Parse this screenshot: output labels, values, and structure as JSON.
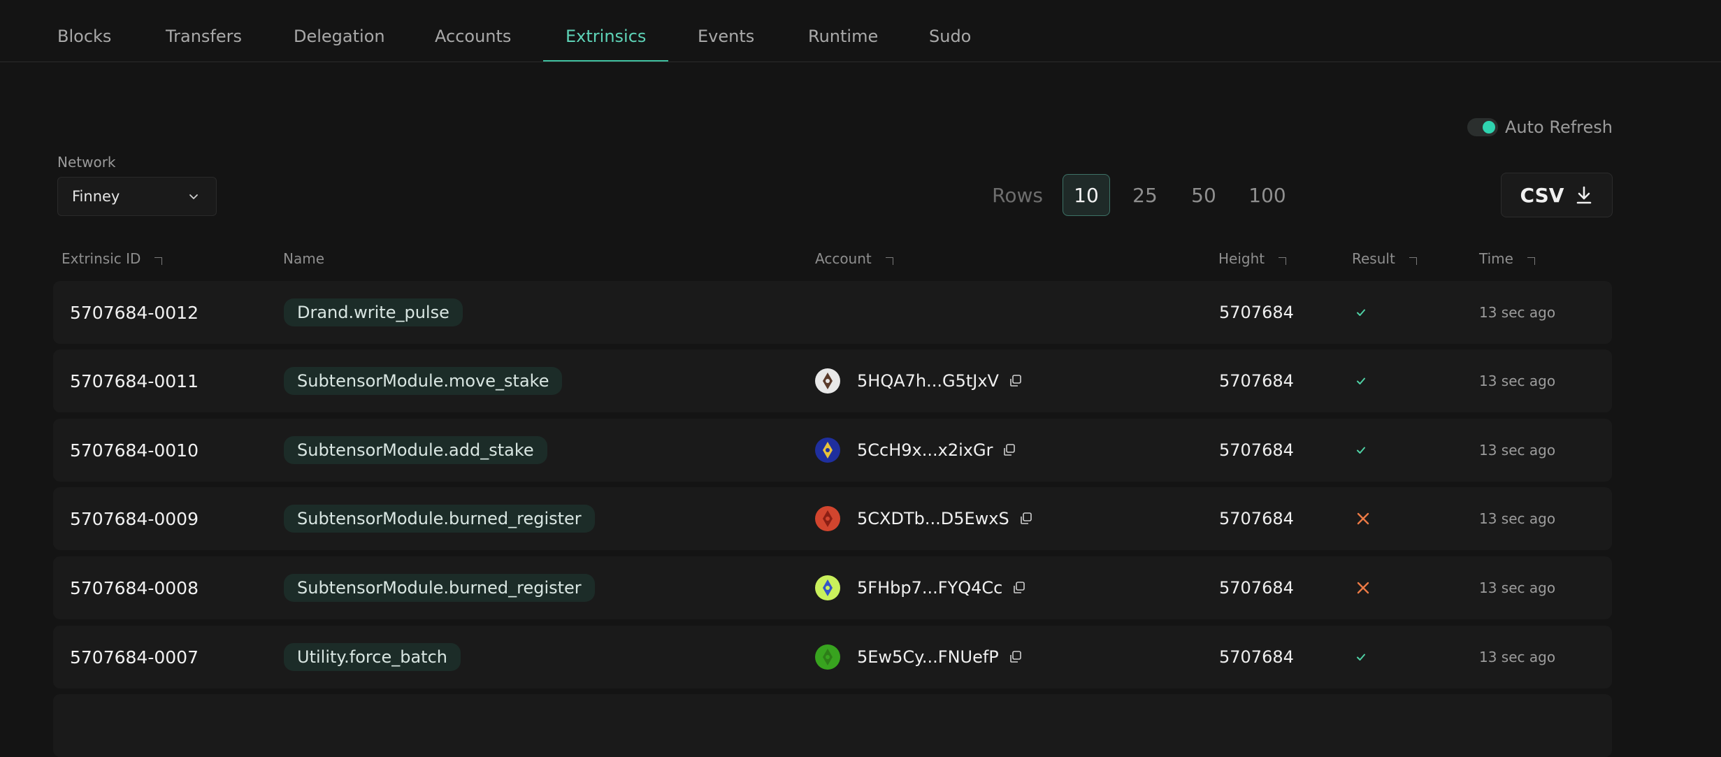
{
  "nav": {
    "tabs": [
      {
        "label": "Blocks"
      },
      {
        "label": "Transfers"
      },
      {
        "label": "Delegation"
      },
      {
        "label": "Accounts"
      },
      {
        "label": "Extrinsics",
        "active": true
      },
      {
        "label": "Events"
      },
      {
        "label": "Runtime"
      },
      {
        "label": "Sudo"
      }
    ]
  },
  "controls": {
    "auto_refresh_label": "Auto Refresh",
    "auto_refresh_on": true,
    "network_label": "Network",
    "network_value": "Finney",
    "rows_label": "Rows",
    "rows_options": [
      "10",
      "25",
      "50",
      "100"
    ],
    "rows_selected": "10",
    "csv_label": "CSV"
  },
  "table": {
    "headers": {
      "id": "Extrinsic ID",
      "name": "Name",
      "account": "Account",
      "height": "Height",
      "result": "Result",
      "time": "Time"
    },
    "rows": [
      {
        "id": "5707684-0012",
        "name": "Drand.write_pulse",
        "account": "",
        "avatar_colors": [],
        "height": "5707684",
        "result": "success",
        "time": "13 sec ago"
      },
      {
        "id": "5707684-0011",
        "name": "SubtensorModule.move_stake",
        "account": "5HQA7h...G5tJxV",
        "avatar_colors": [
          "#e8e8e8",
          "#5a3a2a"
        ],
        "height": "5707684",
        "result": "success",
        "time": "13 sec ago"
      },
      {
        "id": "5707684-0010",
        "name": "SubtensorModule.add_stake",
        "account": "5CcH9x...x2ixGr",
        "avatar_colors": [
          "#1f2f9e",
          "#e8c23a"
        ],
        "height": "5707684",
        "result": "success",
        "time": "13 sec ago"
      },
      {
        "id": "5707684-0009",
        "name": "SubtensorModule.burned_register",
        "account": "5CXDTb...D5EwxS",
        "avatar_colors": [
          "#d2452e",
          "#8c1f14"
        ],
        "height": "5707684",
        "result": "failed",
        "time": "13 sec ago"
      },
      {
        "id": "5707684-0008",
        "name": "SubtensorModule.burned_register",
        "account": "5FHbp7...FYQ4Cc",
        "avatar_colors": [
          "#c9f05c",
          "#3454c8"
        ],
        "height": "5707684",
        "result": "failed",
        "time": "13 sec ago"
      },
      {
        "id": "5707684-0007",
        "name": "Utility.force_batch",
        "account": "5Ew5Cy...FNUefP",
        "avatar_colors": [
          "#38a31f",
          "#2d7e18"
        ],
        "height": "5707684",
        "result": "success",
        "time": "13 sec ago"
      }
    ]
  },
  "colors": {
    "accent": "#5ed3b7",
    "success": "#4fd1a5",
    "failed": "#ec7a45",
    "background": "#141414",
    "row_background": "#1a1a1a"
  }
}
